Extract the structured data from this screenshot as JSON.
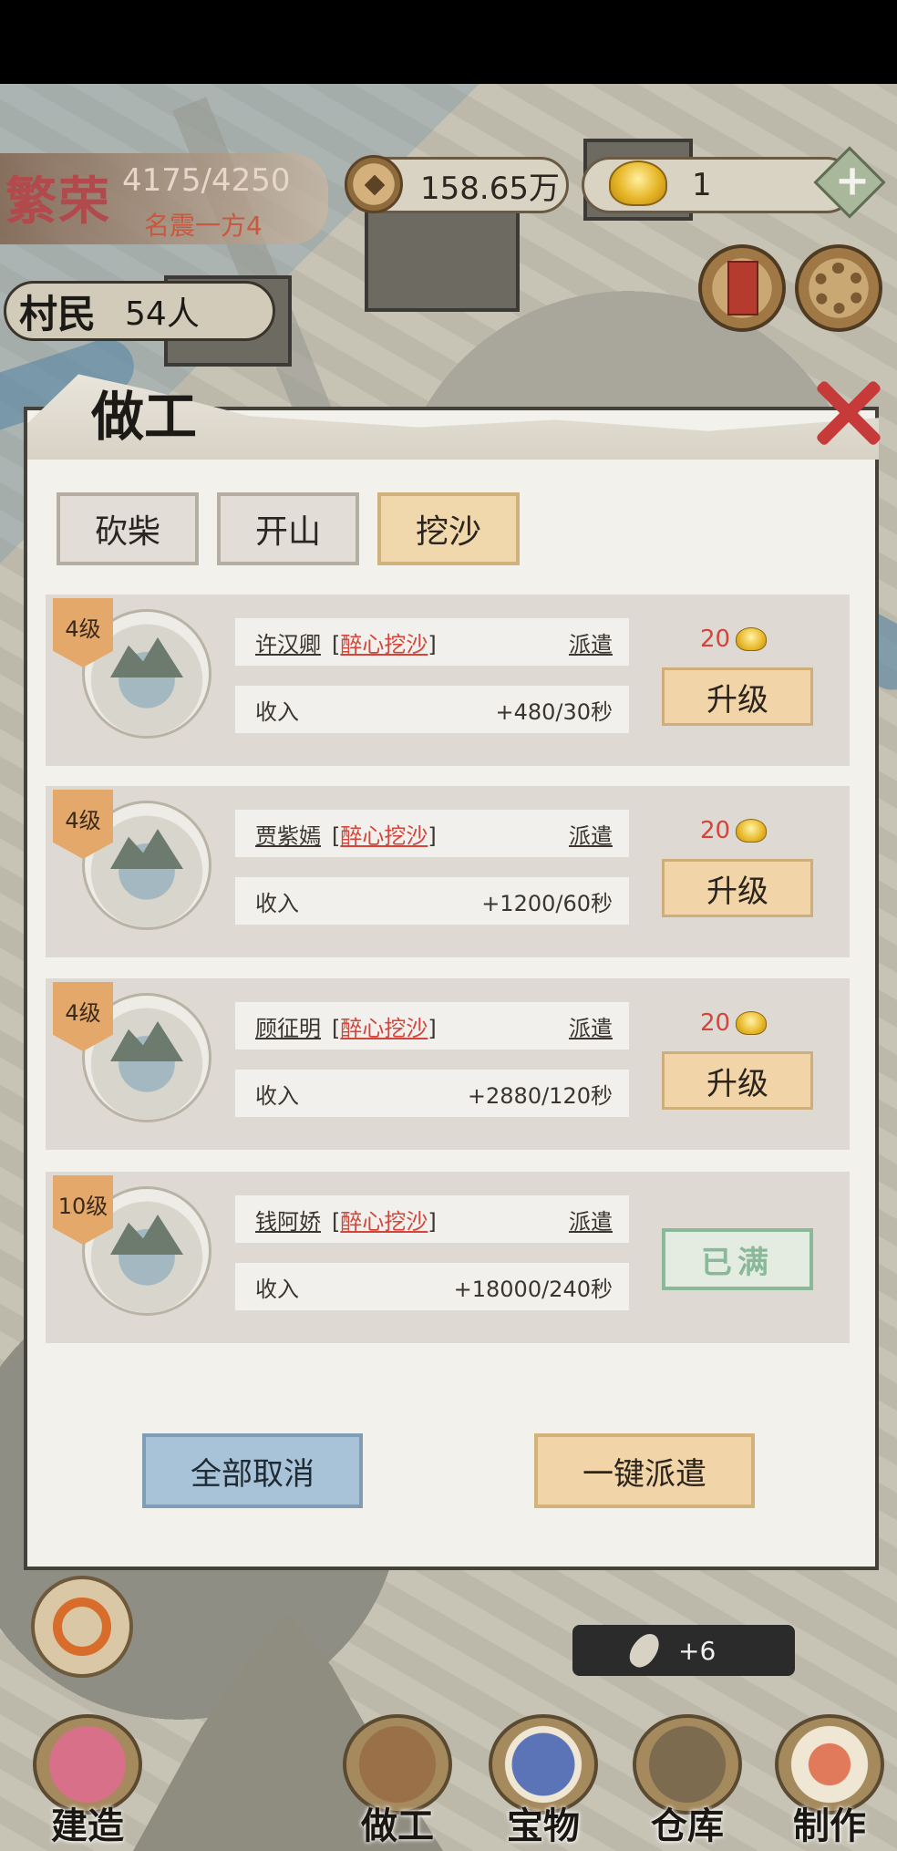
{
  "hud": {
    "title": "繁荣",
    "progress": "4175/4250",
    "subtitle": "名震一方4",
    "coins": "158.65万",
    "gold": "1",
    "villager_label": "村民",
    "villager_count": "54人"
  },
  "dialog": {
    "title": "做工",
    "tabs": [
      {
        "label": "砍柴",
        "active": false
      },
      {
        "label": "开山",
        "active": false
      },
      {
        "label": "挖沙",
        "active": true
      }
    ],
    "workers": [
      {
        "level": "4级",
        "name": "许汉卿",
        "skill": "醉心挖沙",
        "dispatch": "派遣",
        "income_label": "收入",
        "income": "+480/30秒",
        "cost": "20",
        "action": "升级"
      },
      {
        "level": "4级",
        "name": "贾紫嫣",
        "skill": "醉心挖沙",
        "dispatch": "派遣",
        "income_label": "收入",
        "income": "+1200/60秒",
        "cost": "20",
        "action": "升级"
      },
      {
        "level": "4级",
        "name": "顾征明",
        "skill": "醉心挖沙",
        "dispatch": "派遣",
        "income_label": "收入",
        "income": "+2880/120秒",
        "cost": "20",
        "action": "升级"
      },
      {
        "level": "10级",
        "name": "钱阿娇",
        "skill": "醉心挖沙",
        "dispatch": "派遣",
        "income_label": "收入",
        "income": "+18000/240秒",
        "status": "已满"
      }
    ],
    "cancel_all": "全部取消",
    "dispatch_all": "一键派遣"
  },
  "toast": {
    "text": "+6"
  },
  "nav": {
    "build": "建造",
    "work": "做工",
    "treasure": "宝物",
    "warehouse": "仓库",
    "craft": "制作"
  }
}
